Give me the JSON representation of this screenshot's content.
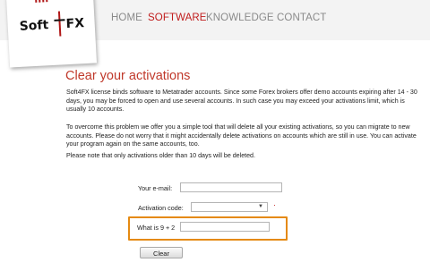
{
  "brand": {
    "logo_text_left": "Soft",
    "logo_text_right": "FX",
    "accent_color": "#c01c1c"
  },
  "nav": [
    {
      "label": "HOME",
      "active": false
    },
    {
      "label": "SOFTWARE",
      "active": true
    },
    {
      "label": "KNOWLEDGE",
      "active": false
    },
    {
      "label": "CONTACT",
      "active": false
    }
  ],
  "page": {
    "title": "Clear your activations",
    "paragraphs": [
      "Soft4FX license binds software to Metatrader accounts. Since some Forex brokers offer demo accounts expiring after 14 - 30 days, you may be forced to open and use several accounts. In such case you may exceed your activations limit, which is usually 10 accounts.",
      "To overcome this problem we offer you a simple tool that will delete all your existing activations, so you can migrate to new accounts. Please do not worry that it might accidentally delete activations on accounts which are still in use. You can activate your program again on the same accounts, too.",
      "Please note that only activations older than 10 days will be deleted."
    ]
  },
  "form": {
    "email_label": "Your e-mail:",
    "email_value": "",
    "activation_label": "Activation code:",
    "activation_value": "",
    "captcha_label": "What is 9 + 2",
    "captcha_value": "",
    "highlight_color": "#e58a12",
    "clear_button": "Clear"
  }
}
